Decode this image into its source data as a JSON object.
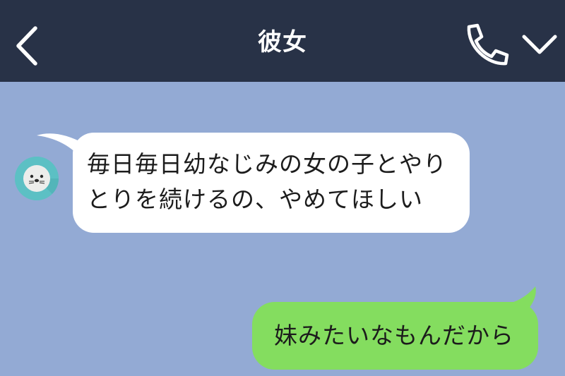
{
  "header": {
    "title": "彼女",
    "back_icon": "chevron-left-icon",
    "call_icon": "phone-icon",
    "menu_icon": "chevron-down-icon"
  },
  "messages": [
    {
      "from": "other",
      "avatar_icon": "seal-avatar-icon",
      "lines": [
        "毎日毎日幼なじみの女の子とやり",
        "とりを続けるの、やめてほしい"
      ]
    },
    {
      "from": "me",
      "lines": [
        "妹みたいなもんだから"
      ]
    }
  ],
  "colors": {
    "header_bg": "#283247",
    "chat_bg": "#93aad4",
    "incoming_bubble": "#ffffff",
    "outgoing_bubble": "#84dd5f",
    "avatar_bg": "#5cc0c4"
  }
}
